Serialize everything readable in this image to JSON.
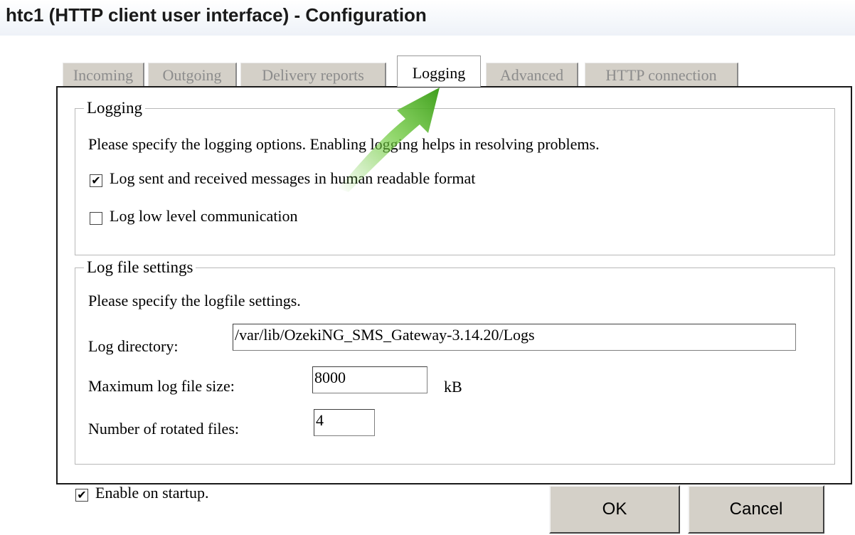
{
  "window": {
    "title": "htc1 (HTTP client user interface) - Configuration"
  },
  "tabs": [
    {
      "label": "Incoming",
      "active": false
    },
    {
      "label": "Outgoing",
      "active": false
    },
    {
      "label": "Delivery reports",
      "active": false
    },
    {
      "label": "Logging",
      "active": true
    },
    {
      "label": "Advanced",
      "active": false
    },
    {
      "label": "HTTP connection",
      "active": false
    }
  ],
  "logging": {
    "legend": "Logging",
    "description": "Please specify the logging options. Enabling logging helps in resolving problems.",
    "log_messages": {
      "label": "Log sent and received messages in human readable format",
      "checked": true
    },
    "log_low_level": {
      "label": "Log low level communication",
      "checked": false
    }
  },
  "logfile": {
    "legend": "Log file settings",
    "description": "Please specify the logfile settings.",
    "directory": {
      "label": "Log directory:",
      "value": "/var/lib/OzekiNG_SMS_Gateway-3.14.20/Logs"
    },
    "max_size": {
      "label": "Maximum log file size:",
      "value": "8000",
      "unit": "kB"
    },
    "rotated": {
      "label": "Number of rotated files:",
      "value": "4"
    }
  },
  "footer": {
    "enable_startup": {
      "label": "Enable on startup.",
      "checked": true
    },
    "ok_label": "OK",
    "cancel_label": "Cancel"
  },
  "colors": {
    "arrow": "#6cc93a",
    "tab_inactive": "#d4d0c8",
    "panel_border": "#1a1a1a"
  },
  "icons": {
    "checkmark": "check-mark-icon",
    "arrow": "pointer-arrow-icon"
  }
}
